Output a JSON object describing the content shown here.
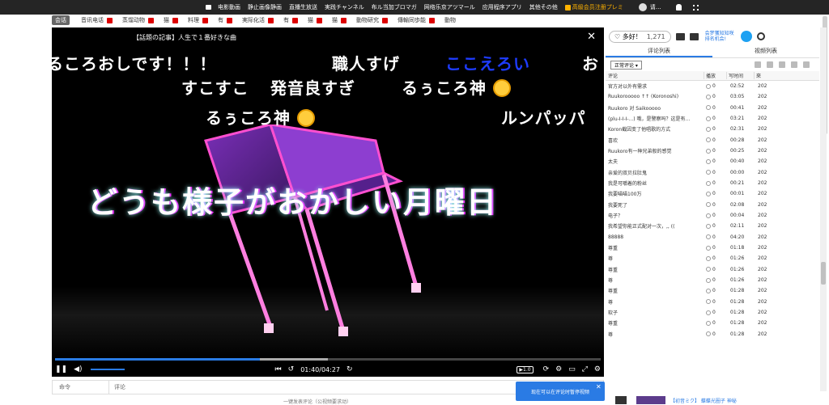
{
  "topbar": {
    "links": [
      "电影動画",
      "静止画像静画",
      "直播生放送",
      "実践チャンネル",
      "布ル当加ブロマガ",
      "网络乐京アツマール",
      "应用程序アプリ",
      "其他その他"
    ],
    "premium_label": "高級会员注册プレミ",
    "user_name": "请…"
  },
  "catbar": {
    "first": "会话",
    "items": [
      "音讯电话",
      "蒸馏动物",
      "猫",
      "料理",
      "有",
      "実际化活",
      "有",
      "猫",
      "猫",
      "動物研究",
      "傳輸同歩能",
      "動物"
    ]
  },
  "player": {
    "title": "【話題の記事】人生で１番好きな曲",
    "danmaku": [
      {
        "text": "るころおしです！！！",
        "color": "white"
      },
      {
        "text": "職人すげ",
        "color": "white"
      },
      {
        "text": "ここえろい",
        "color": "blue"
      },
      {
        "text": "お",
        "color": "white"
      },
      {
        "text": "すこすこ",
        "color": "white"
      },
      {
        "text": "発音良すぎ",
        "color": "white"
      },
      {
        "text": "るぅころ神",
        "color": "white"
      },
      {
        "text": "るぅころ神",
        "color": "white"
      },
      {
        "text": "ルンパッパ",
        "color": "white"
      }
    ],
    "overlay_text": "どうも様子がおかしい月曜日",
    "time": "01:40/04:27",
    "speed": "▶1.0",
    "progress_fraction": 0.375,
    "buffer_fraction": 0.5
  },
  "comment_bar": {
    "command_label": "命令",
    "input_placeholder": "评论",
    "hint": "一键发表评论（公视频要求动）"
  },
  "side": {
    "like_label": "♡ 多好！",
    "like_count": "1,271",
    "promo_line1": "会梦獲知知咲",
    "promo_line2": "排名机会!",
    "tabs": [
      "评论列表",
      "视频列表"
    ],
    "filter_value": "正常评论",
    "columns": [
      "评论",
      "播放",
      "写时间",
      "來"
    ],
    "rows": [
      {
        "comment": "官方对以外有需求",
        "count": "0",
        "time": "02:52",
        "date": "202"
      },
      {
        "comment": "Ruukorooooo ↑↑ (Koronoshi)",
        "count": "0",
        "time": "03:05",
        "date": "202"
      },
      {
        "comment": "Ruukoro 对 Saikooooo",
        "count": "0",
        "time": "00:41",
        "date": "202"
      },
      {
        "comment": "(plu-I-I-I-...) 哦，是警察吗？这是有…",
        "count": "0",
        "time": "03:21",
        "date": "202"
      },
      {
        "comment": "Koron截因变了他唱歌的方式",
        "count": "0",
        "time": "02:31",
        "date": "202"
      },
      {
        "comment": "喜欢",
        "count": "0",
        "time": "00:28",
        "date": "202"
      },
      {
        "comment": "Ruukoro有一种兄弟般的感觉",
        "count": "0",
        "time": "00:25",
        "date": "202"
      },
      {
        "comment": "太夫",
        "count": "0",
        "time": "00:40",
        "date": "202"
      },
      {
        "comment": "亲爱的双贝拉肚鬼",
        "count": "0",
        "time": "00:00",
        "date": "202"
      },
      {
        "comment": "我是可嚼着的粉丝",
        "count": "0",
        "time": "00:21",
        "date": "202"
      },
      {
        "comment": "我要喵喵100万",
        "count": "0",
        "time": "00:01",
        "date": "202"
      },
      {
        "comment": "我要死了",
        "count": "0",
        "time": "02:08",
        "date": "202"
      },
      {
        "comment": "电子？",
        "count": "0",
        "time": "00:04",
        "date": "202"
      },
      {
        "comment": "我希望你能正式配对一次，,, ((",
        "count": "0",
        "time": "02:11",
        "date": "202"
      },
      {
        "comment": "88888",
        "count": "0",
        "time": "04:20",
        "date": "202"
      },
      {
        "comment": "尊重",
        "count": "0",
        "time": "01:18",
        "date": "202"
      },
      {
        "comment": "尊",
        "count": "0",
        "time": "01:26",
        "date": "202"
      },
      {
        "comment": "尊重",
        "count": "0",
        "time": "01:26",
        "date": "202"
      },
      {
        "comment": "尊",
        "count": "0",
        "time": "01:26",
        "date": "202"
      },
      {
        "comment": "尊重",
        "count": "0",
        "time": "01:28",
        "date": "202"
      },
      {
        "comment": "尊",
        "count": "0",
        "time": "01:28",
        "date": "202"
      },
      {
        "comment": "软子",
        "count": "0",
        "time": "01:28",
        "date": "202"
      },
      {
        "comment": "尊重",
        "count": "0",
        "time": "01:28",
        "date": "202"
      },
      {
        "comment": "尊",
        "count": "0",
        "time": "01:28",
        "date": "202"
      }
    ]
  },
  "toast": {
    "text": "现在可以在评论时暂停视频"
  },
  "bottom_card_text": "【初音ミク】 蝶蝶光圈子 神秘"
}
